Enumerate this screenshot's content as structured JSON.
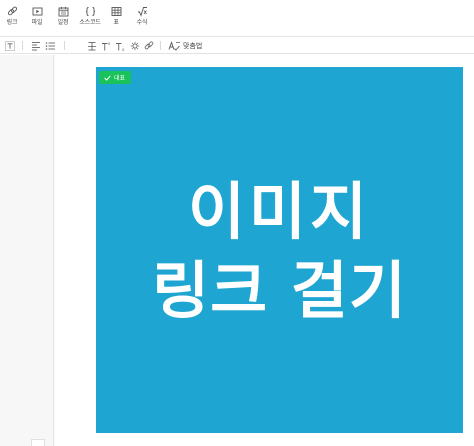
{
  "toolbar": {
    "items": [
      {
        "label": "링크",
        "icon": "link-icon"
      },
      {
        "label": "파일",
        "icon": "file-icon"
      },
      {
        "label": "일정",
        "icon": "calendar-icon"
      },
      {
        "label": "소스코드",
        "icon": "code-icon"
      },
      {
        "label": "표",
        "icon": "table-icon"
      },
      {
        "label": "수식",
        "icon": "formula-icon"
      }
    ]
  },
  "format_bar": {
    "spellcheck_label": "맞춤법"
  },
  "image": {
    "badge_label": "대표",
    "line1": "이미지",
    "line2": "링크 걸기",
    "background_color": "#1ea5d1",
    "badge_color": "#19c35a"
  }
}
